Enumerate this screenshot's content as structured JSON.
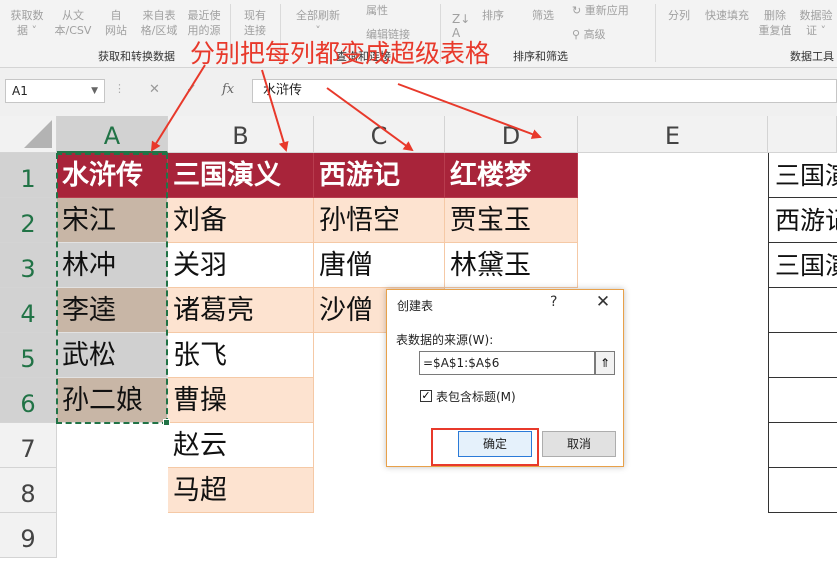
{
  "ribbon": {
    "get_data_group": "获取和转换数据",
    "queries_group": "查询和连接",
    "sort_group": "排序和筛选",
    "data_tools_group": "数据工具",
    "buttons": {
      "get_data": "获取数\n据 ˅",
      "from_csv": "从文\n本/CSV",
      "from_web": "自\n网站",
      "from_table": "来自表\n格/区域",
      "recent": "最近使\n用的源",
      "existing": "现有\n连接",
      "refresh_all": "全部刷新\n˅",
      "properties": "属性",
      "edit_links": "编辑链接",
      "sort": "排序",
      "filter": "筛选",
      "reapply": "重新应用",
      "advanced": "高级",
      "split": "分列",
      "flash_fill": "快速填充",
      "remove_dup": "删除\n重复值",
      "validation": "数据验\n证 ˅"
    }
  },
  "formula_bar": {
    "name_box": "A1",
    "cancel_icon": "✕",
    "enter_icon": "✓",
    "fx_label": "fx",
    "formula": "水浒传"
  },
  "annotation": "分别把每列都变成超级表格",
  "columns": [
    "A",
    "B",
    "C",
    "D",
    "E"
  ],
  "rows": [
    "1",
    "2",
    "3",
    "4",
    "5",
    "6",
    "7",
    "8",
    "9"
  ],
  "cells": {
    "A": [
      "水浒传",
      "宋江",
      "林冲",
      "李逵",
      "武松",
      "孙二娘"
    ],
    "B": [
      "三国演义",
      "刘备",
      "关羽",
      "诸葛亮",
      "张飞",
      "曹操",
      "赵云",
      "马超"
    ],
    "C": [
      "西游记",
      "孙悟空",
      "唐僧",
      "沙僧"
    ],
    "D": [
      "红楼梦",
      "贾宝玉",
      "林黛玉"
    ]
  },
  "edge_cells": [
    "三国演义",
    "西游记",
    "三国演义"
  ],
  "dialog": {
    "title": "创建表",
    "help": "?",
    "close": "✕",
    "source_label": "表数据的来源(W):",
    "range": "=$A$1:$A$6",
    "collapse_icon": "⇑",
    "has_headers_label": "表包含标题(M)",
    "has_headers_checked": "✓",
    "ok": "确定",
    "cancel": "取消"
  },
  "colors": {
    "header_fill": "#a8243a",
    "band_fill": "#fde3d0",
    "selection": "#217346",
    "annotation": "#e8392b"
  }
}
